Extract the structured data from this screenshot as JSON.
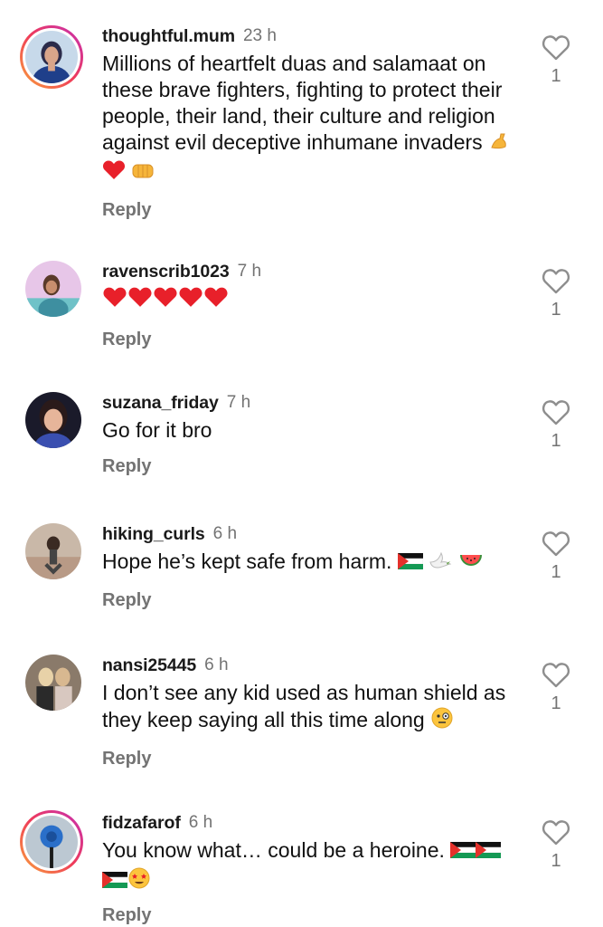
{
  "comments": [
    {
      "username": "thoughtful.mum",
      "time": "23 h",
      "text": "Millions of heartfelt duas and salamaat on these brave fighters, fighting to protect their people, their land, their culture and religion against evil deceptive inhumane invaders",
      "emojis": [
        "flexed-biceps",
        "red-heart",
        "oncoming-fist"
      ],
      "reply_label": "Reply",
      "like_count": "1",
      "story_ring": true
    },
    {
      "username": "ravenscrib1023",
      "time": "7 h",
      "text": "",
      "emojis": [
        "red-heart",
        "red-heart",
        "red-heart",
        "red-heart",
        "red-heart"
      ],
      "reply_label": "Reply",
      "like_count": "1",
      "story_ring": false
    },
    {
      "username": "suzana_friday",
      "time": "7 h",
      "text": "Go for it bro",
      "emojis": [],
      "reply_label": "Reply",
      "like_count": "1",
      "story_ring": false
    },
    {
      "username": "hiking_curls",
      "time": "6 h",
      "text": "Hope he’s kept safe from harm.",
      "emojis": [
        "palestine-flag",
        "dove",
        "watermelon"
      ],
      "reply_label": "Reply",
      "like_count": "1",
      "story_ring": false
    },
    {
      "username": "nansi25445",
      "time": "6 h",
      "text": "I don’t see any kid used as human shield as they keep saying all this time along",
      "emojis": [
        "face-with-monocle"
      ],
      "reply_label": "Reply",
      "like_count": "1",
      "story_ring": false
    },
    {
      "username": "fidzafarof",
      "time": "6 h",
      "text": "You know what… could be a heroine.",
      "emojis": [
        "palestine-flag",
        "palestine-flag",
        "palestine-flag",
        "star-struck"
      ],
      "reply_label": "Reply",
      "like_count": "1",
      "story_ring": true
    }
  ],
  "colors": {
    "text": "#111111",
    "secondary": "#737373",
    "heart_outline": "#8e8e8e",
    "story_gradient": [
      "#f9a43a",
      "#ef3b5a",
      "#c52fb4"
    ]
  }
}
